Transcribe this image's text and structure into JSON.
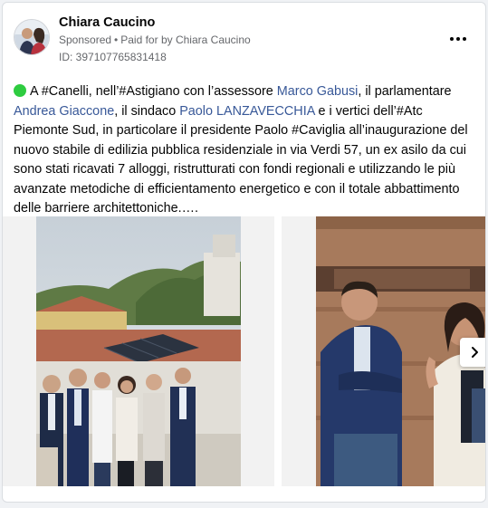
{
  "post": {
    "author": "Chiara Caucino",
    "sponsored_label": "Sponsored",
    "separator": "•",
    "paid_for_prefix": "Paid for by",
    "paid_for_by": "Chiara Caucino",
    "ad_id": "ID: 397107765831418",
    "text": {
      "part1": "A #Canelli, nell’#Astigiano con l’assessore ",
      "mention1": "Marco Gabusi",
      "part2": ", il parlamentare ",
      "mention2": "Andrea Giaccone",
      "part3": ", il sindaco ",
      "mention3": "Paolo LANZAVECCHIA",
      "part4": " e i vertici dell’#Atc Piemonte Sud, in particolare il presidente Paolo #Caviglia all’inaugurazione del nuovo stabile di edilizia pubblica residenziale in via Verdi 57, un ex asilo da cui sono stati ricavati 7 alloggi, ristrutturati con fondi regionali e utilizzando le più avanzate metodiche di efficientamento energetico e con il totale abbattimento delle barriere architettoniche.…."
    }
  },
  "icons": {
    "status": "green-circle-icon",
    "menu": "more-horizontal-icon",
    "next": "chevron-right-icon"
  },
  "colors": {
    "link": "#385898",
    "status_dot": "#2ecc40",
    "secondary_text": "#65676b"
  }
}
